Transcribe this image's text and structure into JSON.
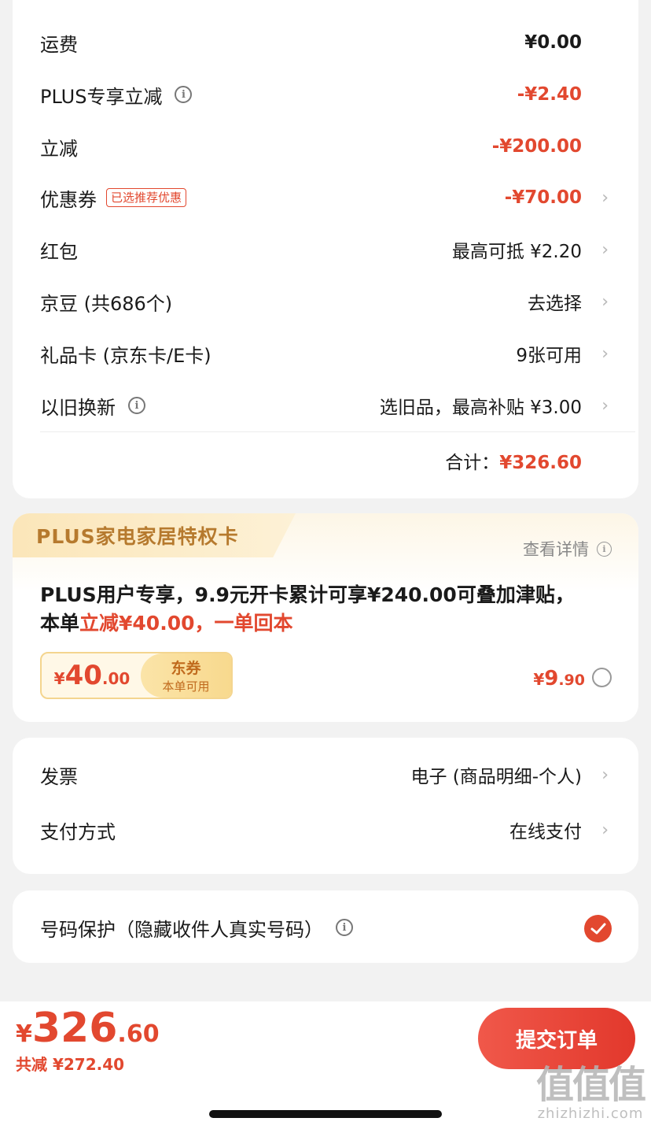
{
  "fees": {
    "rows": [
      {
        "label": "运费",
        "value": "¥0.00"
      },
      {
        "label": "PLUS专享立减",
        "value": "-¥2.40"
      },
      {
        "label": "立减",
        "value": "-¥200.00"
      },
      {
        "label": "优惠券",
        "tag": "已选推荐优惠",
        "value": "-¥70.00"
      },
      {
        "label": "红包",
        "value": "最高可抵 ¥2.20"
      },
      {
        "label": "京豆 (共686个)",
        "value": "去选择"
      },
      {
        "label": "礼品卡 (京东卡/E卡)",
        "value": "9张可用"
      },
      {
        "label": "以旧换新",
        "value": "选旧品，最高补贴 ¥3.00"
      }
    ],
    "total_label": "合计：",
    "total_value": "¥326.60"
  },
  "plus_card": {
    "banner": "PLUS家电家居特权卡",
    "detail_link": "查看详情",
    "desc_part1": "PLUS用户专享，9.9元开卡累计可享¥240.00可叠加津贴，本单",
    "desc_highlight": "立减¥40.00，一单回本",
    "coupon": {
      "currency": "¥",
      "amount": "40",
      "decimal": ".00",
      "title": "东券",
      "subtitle": "本单可用"
    },
    "price": {
      "currency": "¥",
      "integer": "9",
      "decimal": ".90"
    }
  },
  "invoice": {
    "rows": [
      {
        "label": "发票",
        "value": "电子 (商品明细-个人)"
      },
      {
        "label": "支付方式",
        "value": "在线支付"
      }
    ]
  },
  "protect": {
    "label": "号码保护（隐藏收件人真实号码）"
  },
  "bottom": {
    "currency": "¥",
    "integer": "326",
    "decimal": ".60",
    "saved": "共减 ¥272.40",
    "submit": "提交订单"
  },
  "watermark": {
    "main": "值值值",
    "url": "zhizhizhi.com"
  },
  "colors": {
    "accent": "#e2482f",
    "gold": "#b67a2e",
    "background": "#f2f2f2"
  }
}
